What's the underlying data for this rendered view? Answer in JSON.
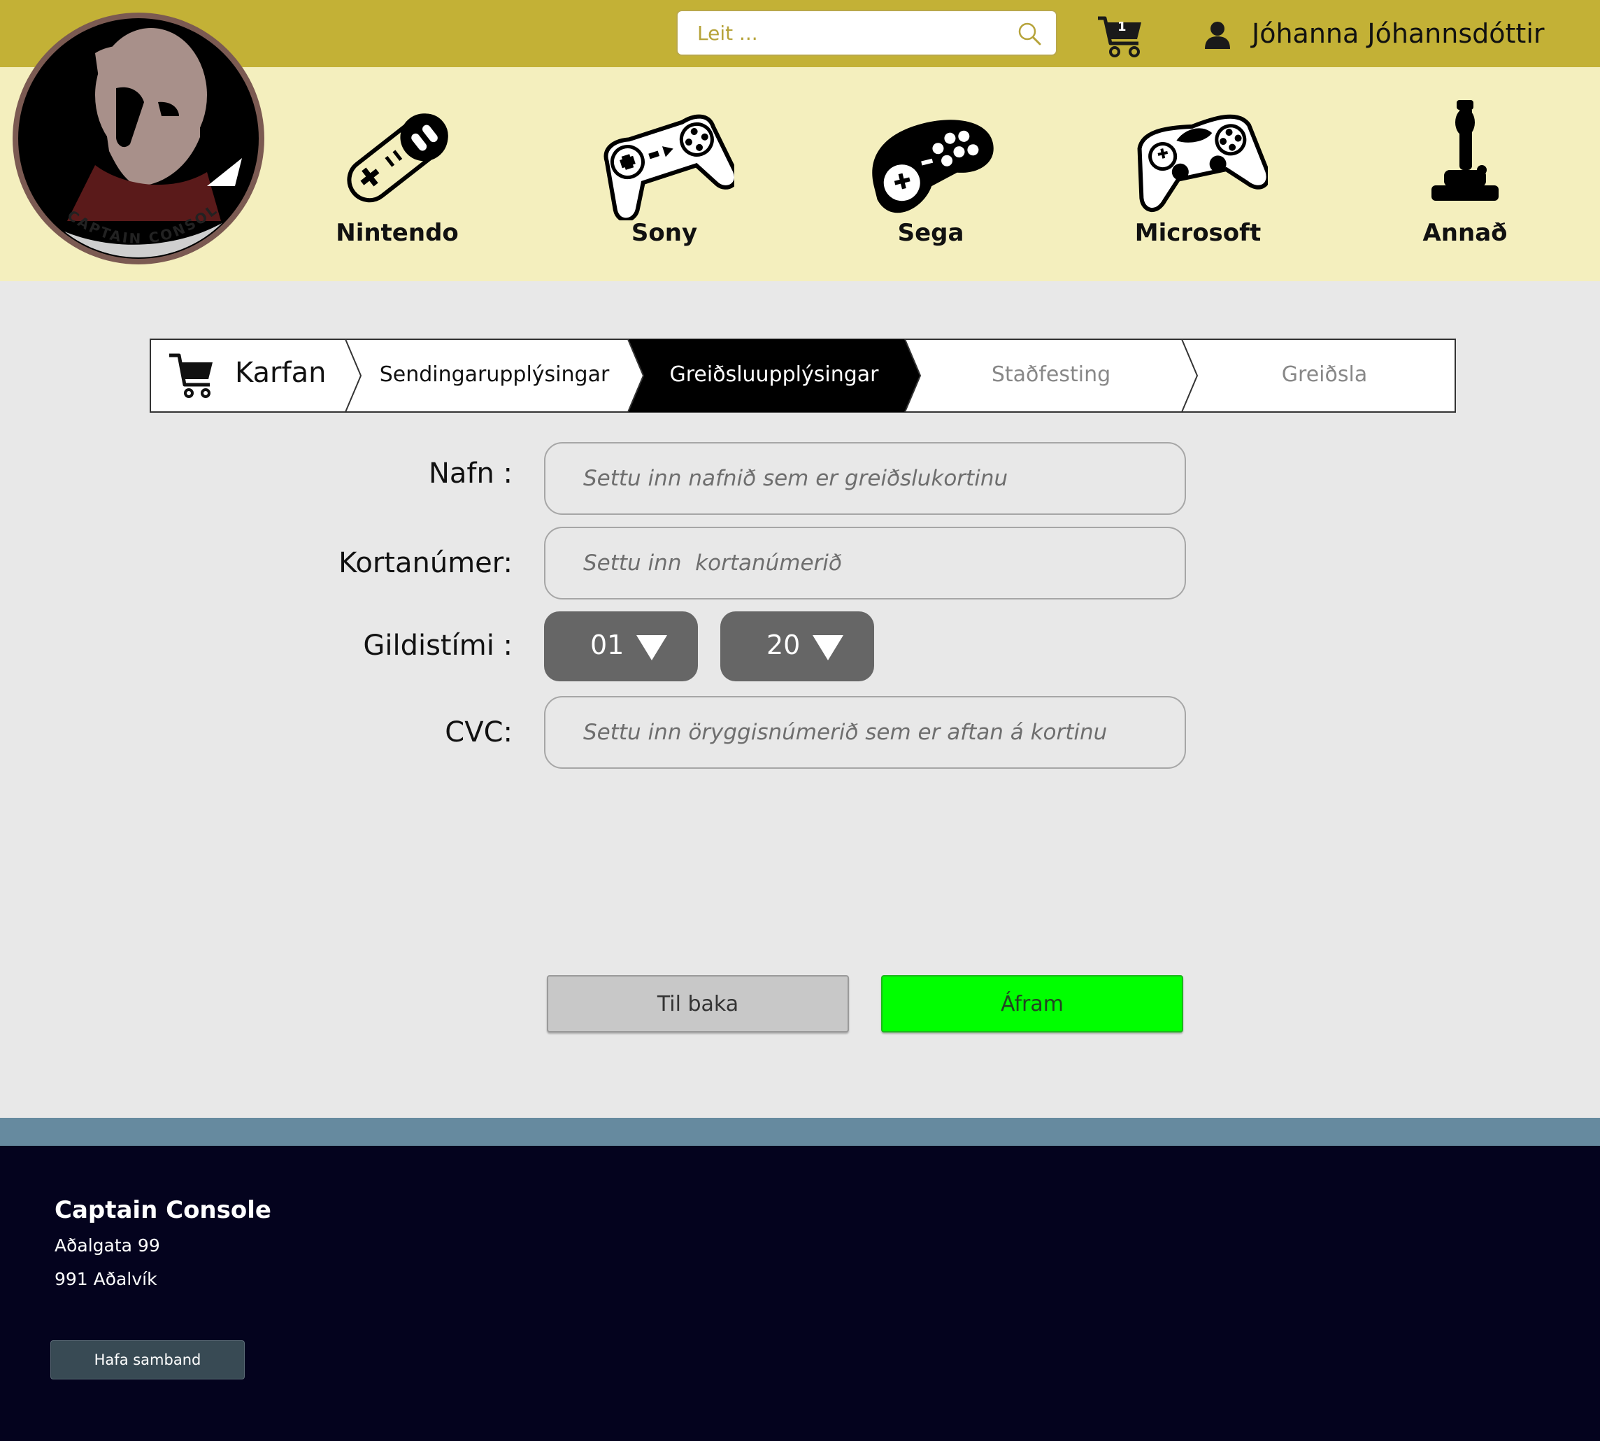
{
  "header": {
    "search": {
      "placeholder": "Leit ..."
    },
    "cart_count": "1",
    "user_name": "Jóhanna Jóhannsdóttir"
  },
  "logo": {
    "text": "CAPTAIN CONSOLE"
  },
  "categories": [
    {
      "label": "Nintendo",
      "icon": "snes-controller-icon"
    },
    {
      "label": "Sony",
      "icon": "playstation-controller-icon"
    },
    {
      "label": "Sega",
      "icon": "sega-controller-icon"
    },
    {
      "label": "Microsoft",
      "icon": "xbox-controller-icon"
    },
    {
      "label": "Annað",
      "icon": "joystick-icon"
    }
  ],
  "stepper": {
    "steps": [
      {
        "label": "Karfan",
        "state": "done"
      },
      {
        "label": "Sendingarupplýsingar",
        "state": "done"
      },
      {
        "label": "Greiðsluupplýsingar",
        "state": "active"
      },
      {
        "label": "Staðfesting",
        "state": "upcoming"
      },
      {
        "label": "Greiðsla",
        "state": "upcoming"
      }
    ]
  },
  "form": {
    "name": {
      "label": "Nafn :",
      "placeholder": "Settu inn nafnið sem er greiðslukortinu"
    },
    "card": {
      "label": "Kortanúmer:",
      "placeholder": "Settu inn  kortanúmerið"
    },
    "expiry": {
      "label": "Gildistími :",
      "month": "01",
      "year": "20"
    },
    "cvc": {
      "label": "CVC:",
      "placeholder": "Settu inn öryggisnúmerið sem er aftan á kortinu"
    }
  },
  "buttons": {
    "back": "Til baka",
    "next": "Áfram"
  },
  "footer": {
    "title": "Captain Console",
    "address_line1": "Aðalgata 99",
    "address_line2": "991 Aðalvík",
    "contact_button": "Hafa samband"
  },
  "colors": {
    "topbar": "#c3b136",
    "category_band": "#f4efbe",
    "page_bg": "#e8e8e8",
    "active_step": "#000000",
    "next_button": "#00ff00",
    "footer_strip": "#668a9f",
    "footer_bg": "#04031e"
  }
}
